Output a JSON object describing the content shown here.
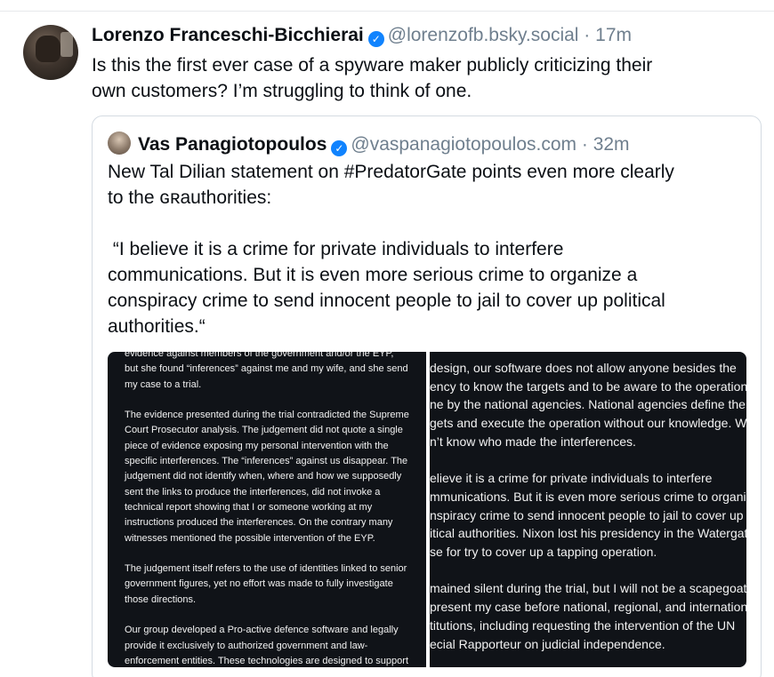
{
  "post": {
    "author_name": "Lorenzo Franceschi-Bicchierai",
    "handle": "@lorenzofb.bsky.social",
    "separator": "·",
    "time": "17m",
    "verified_icon": "check",
    "text_line1": "Is this the first ever case of a spyware maker publicly criticizing their",
    "text_line2": "own customers? I’m struggling to think of one."
  },
  "quote": {
    "author_name": "Vas Panagiotopoulos",
    "handle": "@vaspanagiotopoulos.com",
    "separator": "·",
    "time": "32m",
    "verified_icon": "check",
    "para1_line1": "New Tal Dilian statement on #PredatorGate points even more clearly",
    "para1_line2": "to the ɢʀauthorities:",
    "para2_line1": " “I believe it is a crime for private individuals to interfere",
    "para2_line2": "communications. But it is even more serious crime to organize a",
    "para2_line3": "conspiracy crime to send innocent people to jail to cover up political",
    "para2_line4": "authorities.“"
  },
  "image_left": {
    "lines": [
      "evidence against members of the government and/or the EYP,",
      "but she found “inferences” against me and my wife, and she send",
      "my case to a trial.",
      "",
      "The evidence presented during the trial contradicted the Supreme",
      "Court Prosecutor analysis. The judgement did not quote a single",
      "piece of evidence exposing my personal intervention with the",
      "specific interferences. The “inferences” against us disappear. The",
      "judgement did not identify when, where and how we supposedly",
      "sent the links to produce the interferences, did not invoke a",
      "technical report showing that I or someone working at my",
      "instructions produced the interferences. On the contrary many",
      "witnesses mentioned the possible intervention of the EYP.",
      "",
      "The judgement itself refers to the use of identities linked to senior",
      "government figures, yet no effort was made to fully investigate",
      "those directions.",
      "",
      "Our group developed a Pro-active defence software and legally",
      "provide it exclusively to authorized government and law-",
      "enforcement entities. These technologies are designed to support"
    ]
  },
  "image_right": {
    "lines": [
      "design, our software does not allow anyone besides the",
      "ency to know the targets and to be aware to the operations",
      "ne by the national agencies. National agencies define the",
      "gets and execute the operation without our knowledge. We",
      "n’t know who made the interferences.",
      "",
      "elieve it is a crime for private individuals to interfere",
      "mmunications. But it is even more serious crime to organize",
      "nspiracy crime to send innocent people to jail to cover up",
      "itical authorities. Nixon lost his presidency in the Watergate",
      "se for try to cover up a tapping operation.",
      "",
      "mained silent during the trial, but I will not be a scapegoat. I",
      "present my case before national, regional, and international",
      "titutions, including requesting the intervention of the UN",
      "ecial Rapporteur on judicial independence."
    ]
  }
}
